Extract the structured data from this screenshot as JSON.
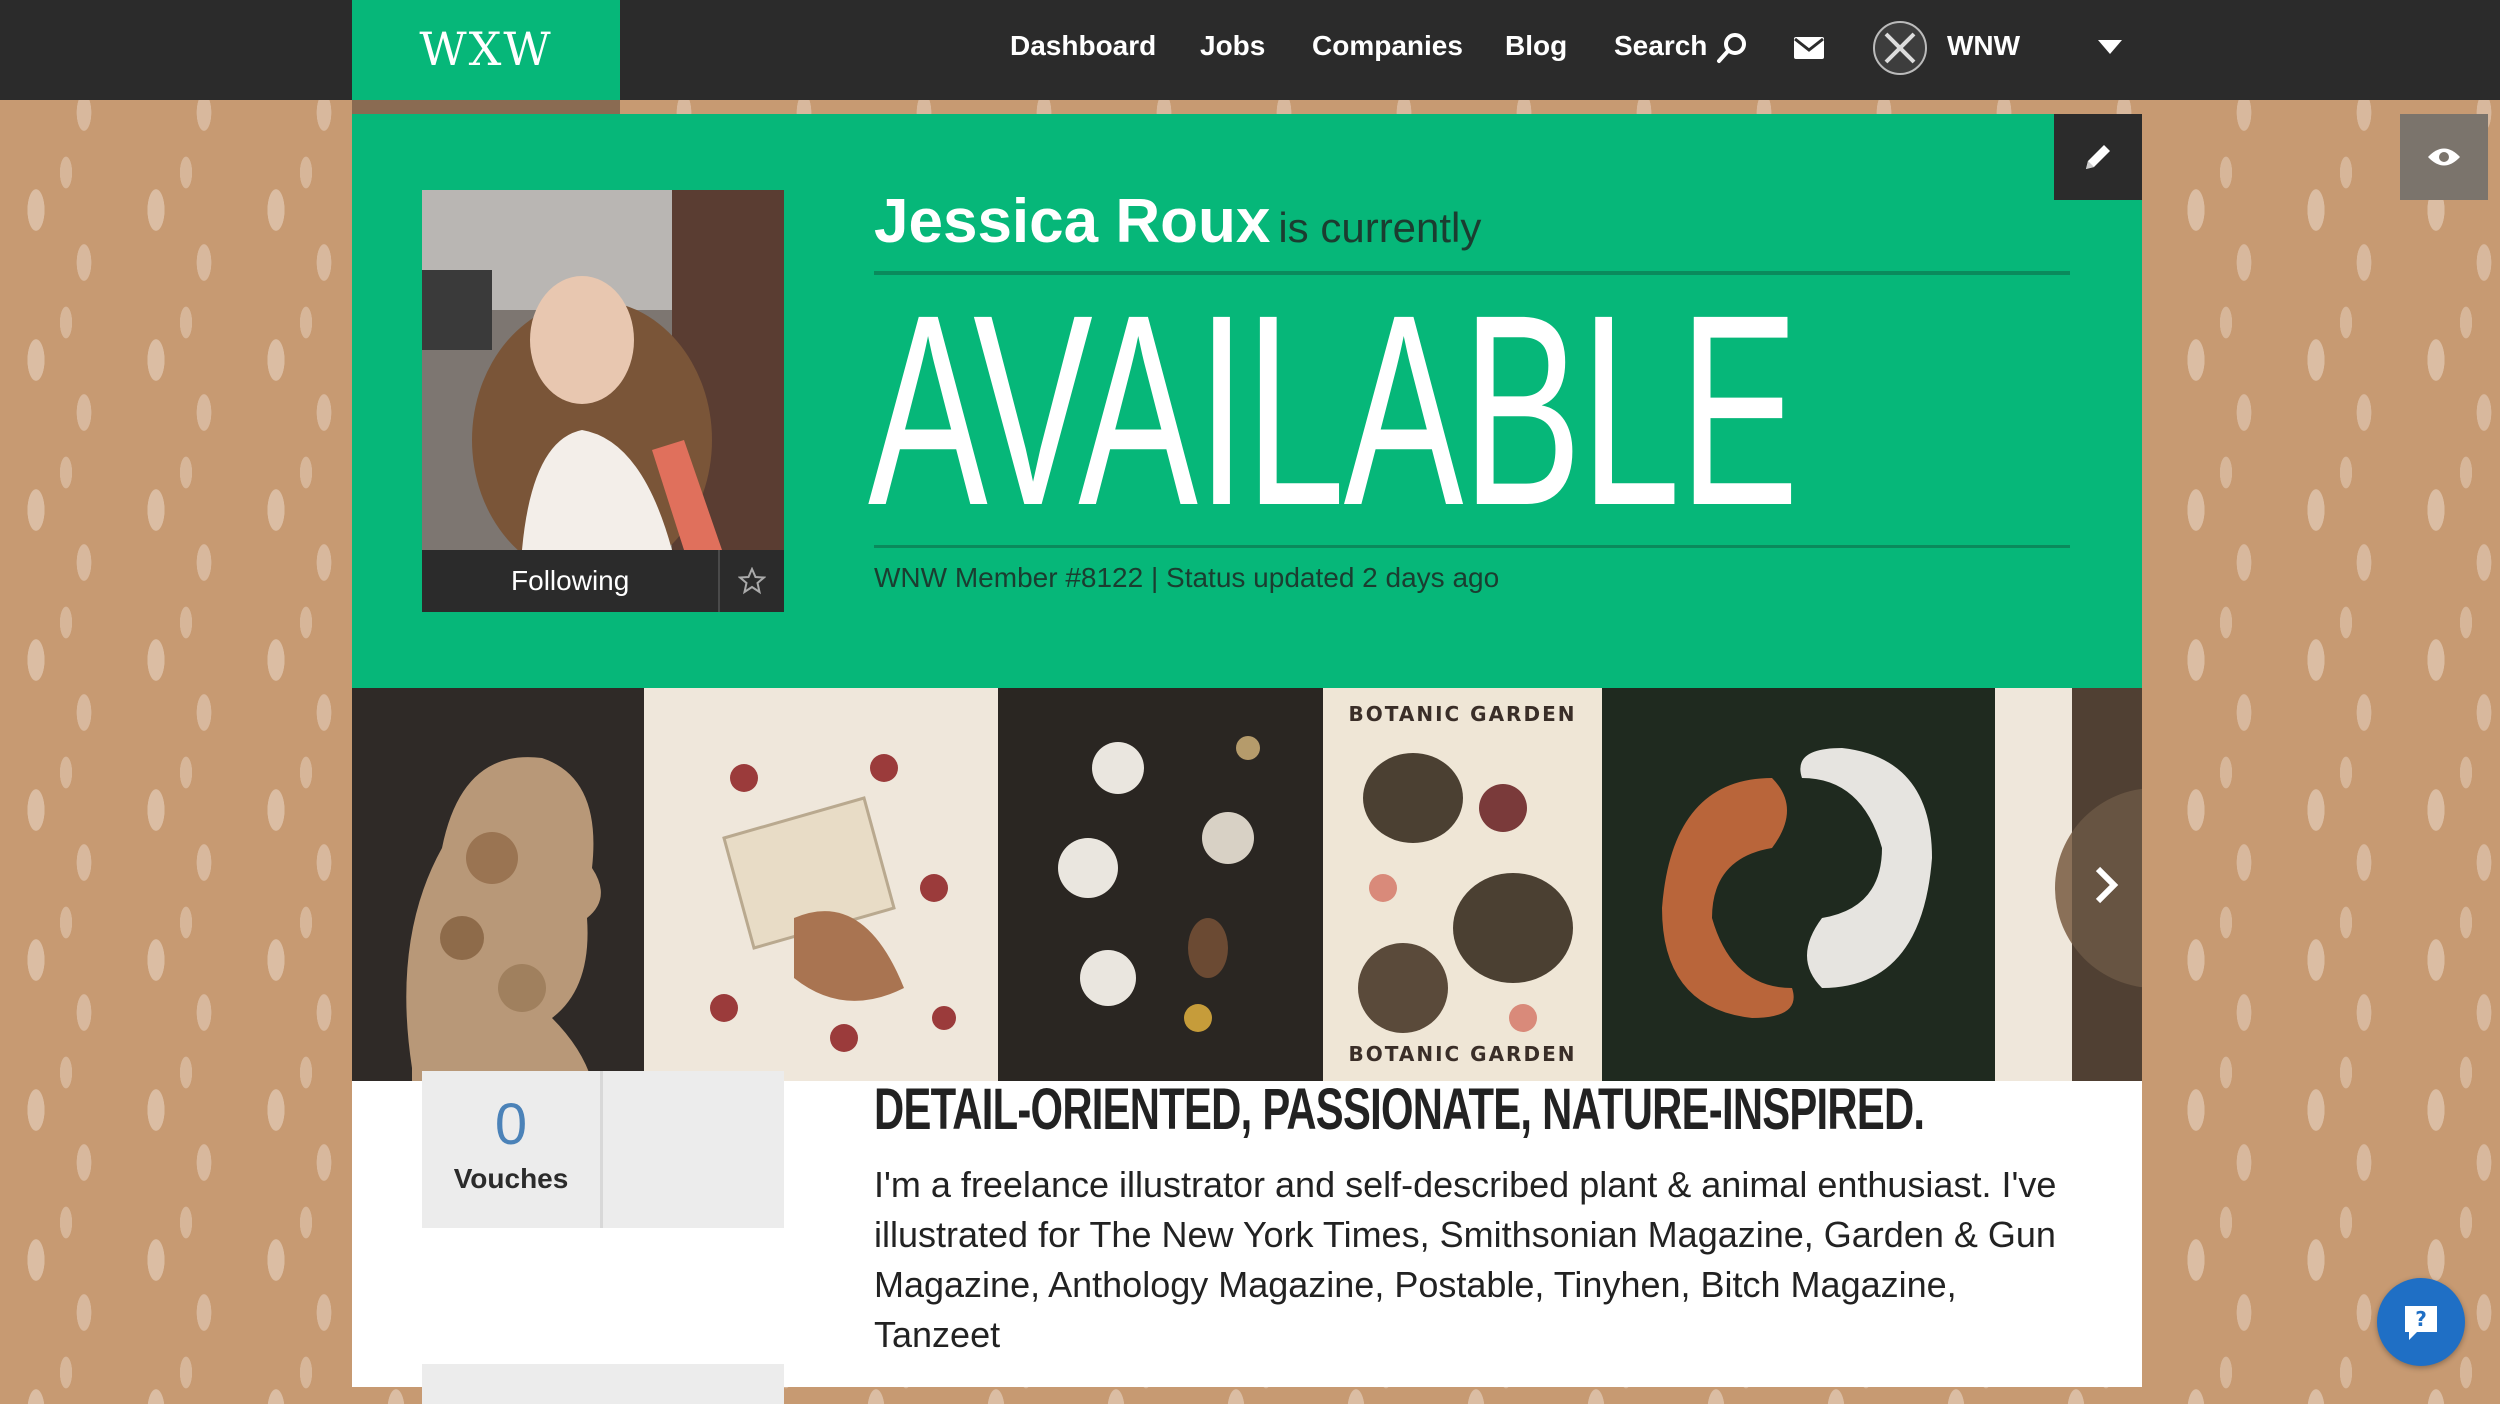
{
  "nav": {
    "logo": "WXW",
    "items": [
      "Dashboard",
      "Jobs",
      "Companies",
      "Blog"
    ],
    "search_label": "Search",
    "account_label": "WNW"
  },
  "profile": {
    "name": "Jessica Roux",
    "currently_text": "is currently",
    "status": "AVAILABLE",
    "meta": "WNW Member #8122 | Status updated 2 days ago",
    "follow_label": "Following"
  },
  "gallery": {
    "labels": [
      "BOTANIC GARDEN",
      "BOTANIC GARDEN"
    ]
  },
  "stats": {
    "vouches_count": "0",
    "vouches_label": "Vouches"
  },
  "about": {
    "headline": "DETAIL-ORIENTED, PASSIONATE, NATURE-INSPIRED.",
    "bio": "I'm a freelance illustrator and self-described plant & animal enthusiast. I've illustrated for The New York Times, Smithsonian Magazine, Garden & Gun Magazine, Anthology Magazine, Postable, Tinyhen, Bitch Magazine, Tanzeet"
  },
  "colors": {
    "brand_green": "#06b779",
    "dark": "#2b2b2b",
    "background": "#c79a72",
    "accent_blue": "#1f6fc5"
  }
}
